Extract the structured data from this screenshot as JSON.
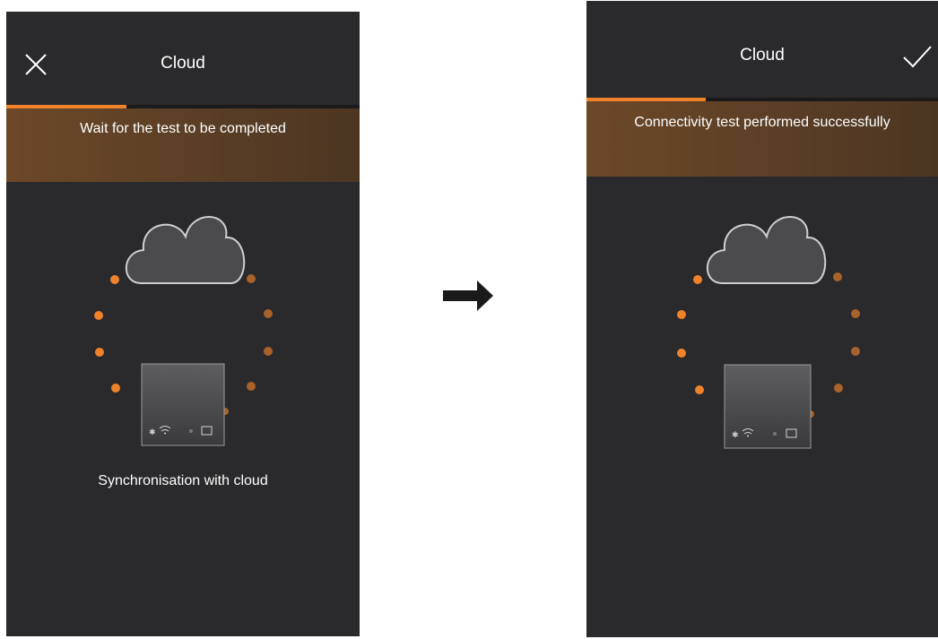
{
  "left_screen": {
    "title": "Cloud",
    "close_icon": "close-icon",
    "progress": 0.34,
    "banner_text": "Wait for the test to be completed",
    "caption": "Synchronisation with cloud"
  },
  "right_screen": {
    "title": "Cloud",
    "confirm_icon": "check-icon",
    "progress": 0.34,
    "banner_text": "Connectivity test performed successfully"
  },
  "arrow_icon": "arrow-right-icon",
  "colors": {
    "screen_bg": "#2a2a2c",
    "accent": "#f0822a",
    "banner": "#5c3f26",
    "text": "#ffffff"
  }
}
